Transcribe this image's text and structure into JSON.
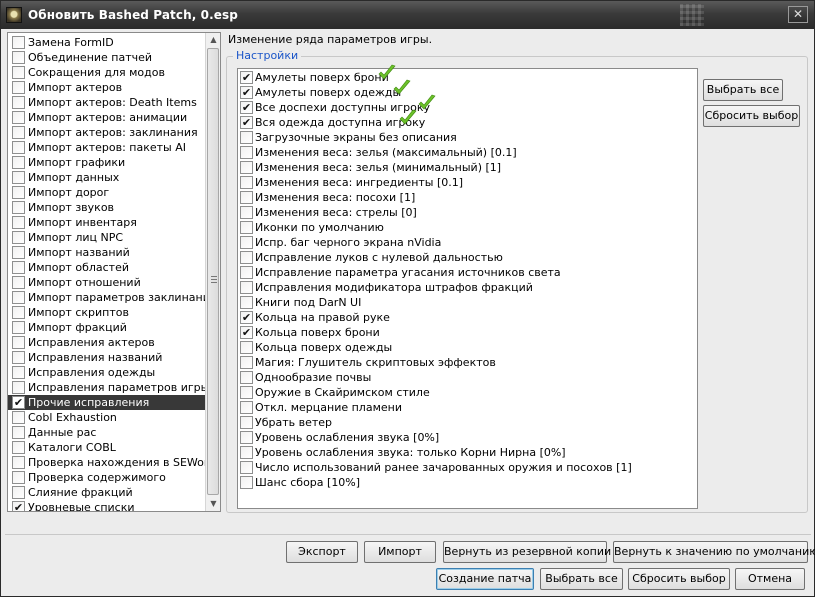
{
  "window": {
    "title": "Обновить Bashed Patch, 0.esp",
    "close_glyph": "✕"
  },
  "left_list": {
    "items": [
      {
        "label": "Замена FormID",
        "checked": false,
        "selected": false
      },
      {
        "label": "Объединение патчей",
        "checked": false,
        "selected": false
      },
      {
        "label": "Сокращения для модов",
        "checked": false,
        "selected": false
      },
      {
        "label": "Импорт актеров",
        "checked": false,
        "selected": false
      },
      {
        "label": "Импорт актеров: Death Items",
        "checked": false,
        "selected": false
      },
      {
        "label": "Импорт актеров: анимации",
        "checked": false,
        "selected": false
      },
      {
        "label": "Импорт актеров: заклинания",
        "checked": false,
        "selected": false
      },
      {
        "label": "Импорт актеров: пакеты AI",
        "checked": false,
        "selected": false
      },
      {
        "label": "Импорт графики",
        "checked": false,
        "selected": false
      },
      {
        "label": "Импорт данных",
        "checked": false,
        "selected": false
      },
      {
        "label": "Импорт дорог",
        "checked": false,
        "selected": false
      },
      {
        "label": "Импорт звуков",
        "checked": false,
        "selected": false
      },
      {
        "label": "Импорт инвентаря",
        "checked": false,
        "selected": false
      },
      {
        "label": "Импорт лиц NPC",
        "checked": false,
        "selected": false
      },
      {
        "label": "Импорт названий",
        "checked": false,
        "selected": false
      },
      {
        "label": "Импорт областей",
        "checked": false,
        "selected": false
      },
      {
        "label": "Импорт отношений",
        "checked": false,
        "selected": false
      },
      {
        "label": "Импорт параметров заклинаний",
        "checked": false,
        "selected": false
      },
      {
        "label": "Импорт скриптов",
        "checked": false,
        "selected": false
      },
      {
        "label": "Импорт фракций",
        "checked": false,
        "selected": false
      },
      {
        "label": "Исправления актеров",
        "checked": false,
        "selected": false
      },
      {
        "label": "Исправления названий",
        "checked": false,
        "selected": false
      },
      {
        "label": "Исправления одежды",
        "checked": false,
        "selected": false
      },
      {
        "label": "Исправления параметров игры",
        "checked": false,
        "selected": false
      },
      {
        "label": "Прочие исправления",
        "checked": true,
        "selected": true
      },
      {
        "label": "Cobl Exhaustion",
        "checked": false,
        "selected": false
      },
      {
        "label": "Данные рас",
        "checked": false,
        "selected": false
      },
      {
        "label": "Каталоги COBL",
        "checked": false,
        "selected": false
      },
      {
        "label": "Проверка нахождения в SEWorld",
        "checked": false,
        "selected": false
      },
      {
        "label": "Проверка содержимого",
        "checked": false,
        "selected": false
      },
      {
        "label": "Слияние фракций",
        "checked": false,
        "selected": false
      },
      {
        "label": "Уровневые списки",
        "checked": true,
        "selected": false
      }
    ]
  },
  "description": "Изменение ряда параметров игры.",
  "settings": {
    "legend": "Настройки",
    "items": [
      {
        "label": "Амулеты поверх брони",
        "checked": true,
        "highlight": true
      },
      {
        "label": "Амулеты поверх одежды",
        "checked": true,
        "highlight": true
      },
      {
        "label": "Все доспехи доступны игроку",
        "checked": true,
        "highlight": true
      },
      {
        "label": "Вся одежда доступна игроку",
        "checked": true,
        "highlight": true
      },
      {
        "label": "Загрузочные экраны без описания",
        "checked": false,
        "highlight": false
      },
      {
        "label": "Изменения веса: зелья (максимальный) [0.1]",
        "checked": false,
        "highlight": false
      },
      {
        "label": "Изменения веса: зелья (минимальный) [1]",
        "checked": false,
        "highlight": false
      },
      {
        "label": "Изменения веса: ингредиенты [0.1]",
        "checked": false,
        "highlight": false
      },
      {
        "label": "Изменения веса: посохи [1]",
        "checked": false,
        "highlight": false
      },
      {
        "label": "Изменения веса: стрелы [0]",
        "checked": false,
        "highlight": false
      },
      {
        "label": "Иконки по умолчанию",
        "checked": false,
        "highlight": false
      },
      {
        "label": "Испр. баг черного экрана nVidia",
        "checked": false,
        "highlight": false
      },
      {
        "label": "Исправление луков с нулевой дальностью",
        "checked": false,
        "highlight": false
      },
      {
        "label": "Исправление параметра угасания источников света",
        "checked": false,
        "highlight": false
      },
      {
        "label": "Исправления модификатора штрафов фракций",
        "checked": false,
        "highlight": false
      },
      {
        "label": "Книги под DarN UI",
        "checked": false,
        "highlight": false
      },
      {
        "label": "Кольца на правой руке",
        "checked": true,
        "highlight": false
      },
      {
        "label": "Кольца поверх брони",
        "checked": true,
        "highlight": false
      },
      {
        "label": "Кольца поверх одежды",
        "checked": false,
        "highlight": false
      },
      {
        "label": "Магия: Глушитель скриптовых эффектов",
        "checked": false,
        "highlight": false
      },
      {
        "label": "Однообразие почвы",
        "checked": false,
        "highlight": false
      },
      {
        "label": "Оружие в Скайримском стиле",
        "checked": false,
        "highlight": false
      },
      {
        "label": "Откл. мерцание пламени",
        "checked": false,
        "highlight": false
      },
      {
        "label": "Убрать ветер",
        "checked": false,
        "highlight": false
      },
      {
        "label": "Уровень ослабления звука [0%]",
        "checked": false,
        "highlight": false
      },
      {
        "label": "Уровень ослабления звука: только Корни Нирна [0%]",
        "checked": false,
        "highlight": false
      },
      {
        "label": "Число использований ранее зачарованных оружия и посохов [1]",
        "checked": false,
        "highlight": false
      },
      {
        "label": "Шанс сбора [10%]",
        "checked": false,
        "highlight": false
      }
    ],
    "select_all": "Выбрать все",
    "reset_selection": "Сбросить выбор"
  },
  "bottom": {
    "export": "Экспорт",
    "import": "Импорт",
    "restore_backup": "Вернуть из резервной копии",
    "restore_default": "Вернуть к значению по умолчанию",
    "create_patch": "Создание патча",
    "select_all": "Выбрать все",
    "reset_selection": "Сбросить выбор",
    "cancel": "Отмена"
  },
  "colors": {
    "tick": "#6cc12a",
    "legend": "#1a55c8",
    "selection": "#383838"
  },
  "icons": {
    "check": "✔",
    "scroll_up": "▲",
    "scroll_down": "▼"
  }
}
